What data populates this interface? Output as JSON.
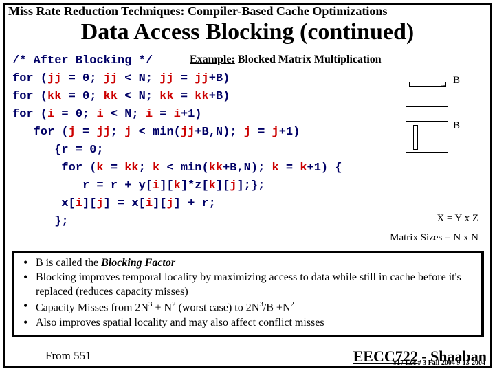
{
  "header": {
    "part1": "Miss Rate Reduction Techniques:",
    "part2": " Compiler-Based Cache Optimizations"
  },
  "title": "Data Access Blocking (continued)",
  "example": {
    "label": "Example:",
    "text": "  Blocked Matrix Multiplication"
  },
  "code": {
    "l1a": "/* After Blocking */",
    "l2a": "for (",
    "l2b": "jj",
    "l2c": " = 0; ",
    "l2d": "jj",
    "l2e": " < N; ",
    "l2f": "jj",
    "l2g": " = ",
    "l2h": "jj",
    "l2i": "+B)",
    "l3a": "for (",
    "l3b": "kk",
    "l3c": " = 0; ",
    "l3d": "kk",
    "l3e": " < N; ",
    "l3f": "kk",
    "l3g": " = ",
    "l3h": "kk",
    "l3i": "+B)",
    "l4a": "for (",
    "l4b": "i",
    "l4c": " = 0; ",
    "l4d": "i",
    "l4e": " < N; ",
    "l4f": "i",
    "l4g": " = ",
    "l4h": "i",
    "l4i": "+1)",
    "l5a": "   for (",
    "l5b": "j",
    "l5c": " = ",
    "l5d": "jj",
    "l5e": "; ",
    "l5f": "j",
    "l5g": " < min(",
    "l5h": "jj",
    "l5i": "+B,N); ",
    "l5j": "j",
    "l5k": " = ",
    "l5l": "j",
    "l5m": "+1)",
    "l6a": "      {r = 0;",
    "l7a": "       for (",
    "l7b": "k",
    "l7c": " = ",
    "l7d": "kk",
    "l7e": "; ",
    "l7f": "k",
    "l7g": " < min(",
    "l7h": "kk",
    "l7i": "+B,N); ",
    "l7j": "k",
    "l7k": " = ",
    "l7l": "k",
    "l7m": "+1) {",
    "l8a": "          r = r + y[",
    "l8b": "i",
    "l8c": "][",
    "l8d": "k",
    "l8e": "]*z[",
    "l8f": "k",
    "l8g": "][",
    "l8h": "j",
    "l8i": "];};",
    "l9a": "       x[",
    "l9b": "i",
    "l9c": "][",
    "l9d": "j",
    "l9e": "] = x[",
    "l9f": "i",
    "l9g": "][",
    "l9h": "j",
    "l9i": "] + r;",
    "l10a": "      };"
  },
  "diagram": {
    "B1": "B",
    "B2": "B"
  },
  "formula": "X = Y x  Z",
  "sizes": "Matrix Sizes = N x N",
  "bullets": {
    "b1a": "B is called the ",
    "b1b": "Blocking Factor",
    "b2": "Blocking improves temporal locality by maximizing access to data while still in cache before it's replaced (reduces capacity misses)",
    "b3a": "Capacity Misses from  2N",
    "b3b": " + N",
    "b3c": " (worst case)  to  2N",
    "b3d": "/B +N",
    "b4": "Also improves spatial locality and may also affect conflict misses"
  },
  "from": "From 551",
  "footer": {
    "course": "EECC722",
    "sep": " - ",
    "author": "Shaaban"
  },
  "slidemeta": "#17   Lec # 3   Fall 2004  9-13-2004"
}
